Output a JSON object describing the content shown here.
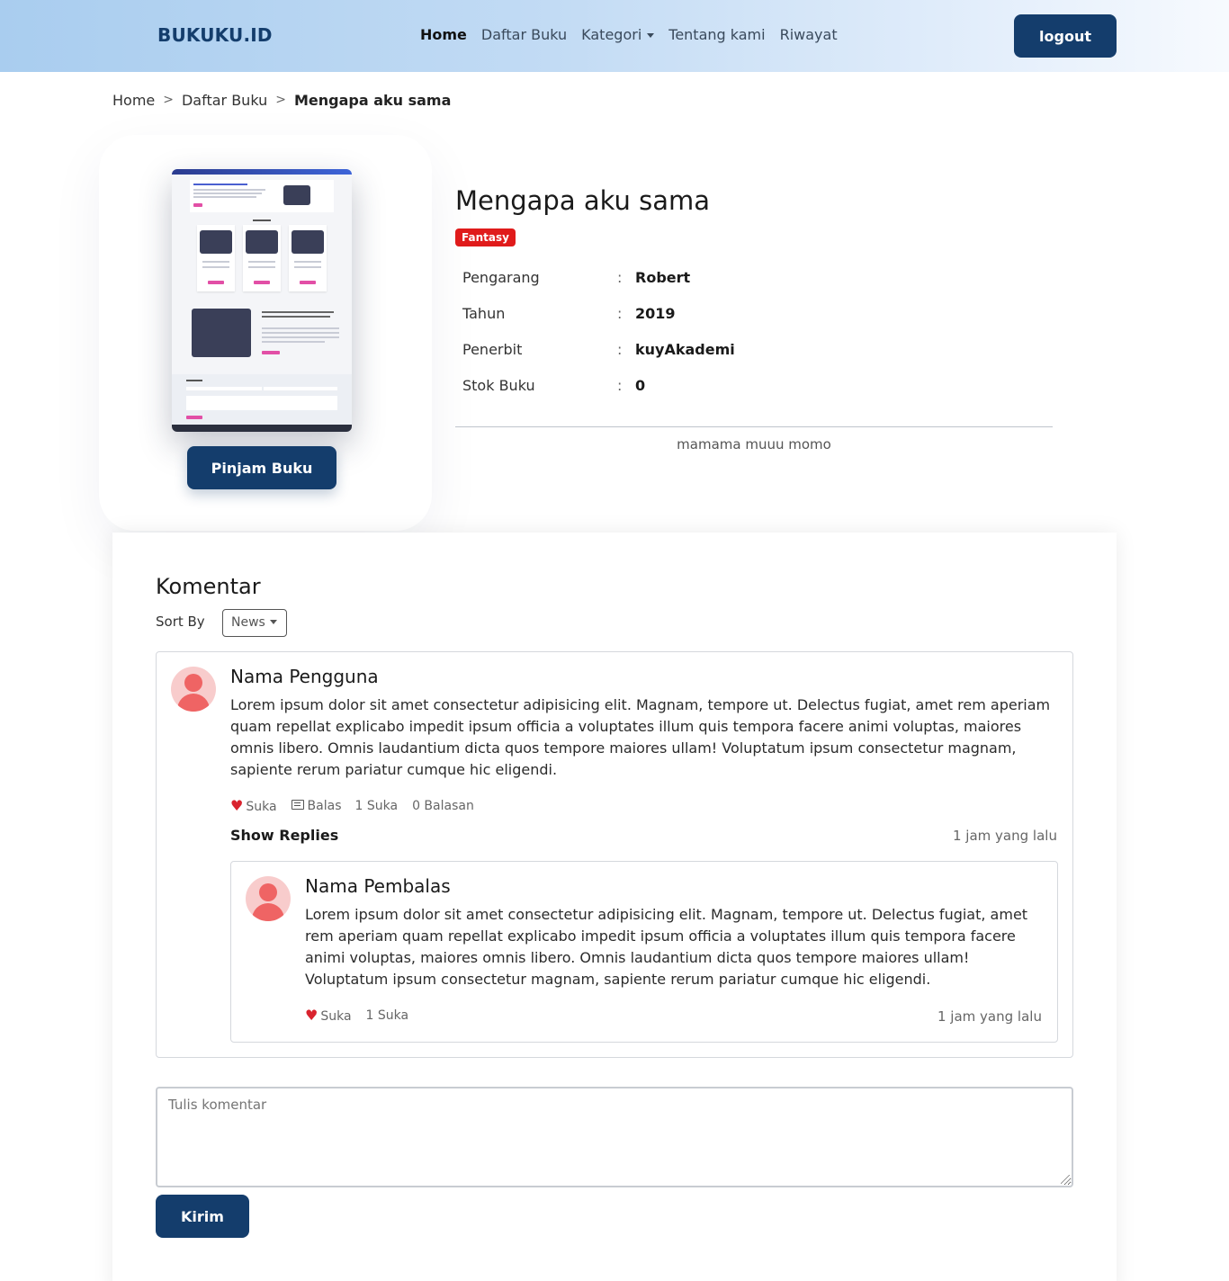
{
  "navbar": {
    "brand": "BUKUKU.ID",
    "links": [
      {
        "label": "Home",
        "active": true
      },
      {
        "label": "Daftar Buku"
      },
      {
        "label": "Kategori",
        "dropdown": true
      },
      {
        "label": "Tentang kami"
      },
      {
        "label": "Riwayat"
      }
    ],
    "logout_label": "logout",
    "colors": {
      "primary": "#143d6c"
    }
  },
  "breadcrumb": {
    "items": [
      "Home",
      "Daftar Buku"
    ],
    "separator": ">",
    "current": "Mengapa aku sama"
  },
  "book": {
    "cover_icon": "book-cover-image",
    "borrow_label": "Pinjam Buku",
    "title": "Mengapa aku sama",
    "category": "Fantasy",
    "category_color": "#e01b1b",
    "details": [
      {
        "label": "Pengarang",
        "value": "Robert"
      },
      {
        "label": "Tahun",
        "value": "2019"
      },
      {
        "label": "Penerbit",
        "value": "kuyAkademi"
      },
      {
        "label": "Stok Buku",
        "value": "0"
      }
    ],
    "colon": ":",
    "description": "mamama muuu momo"
  },
  "comments": {
    "title": "Komentar",
    "sort_label": "Sort By",
    "sort_value": "News",
    "items": [
      {
        "name": "Nama Pengguna",
        "text": "Lorem ipsum dolor sit amet consectetur adipisicing elit. Magnam, tempore ut. Delectus fugiat, amet rem aperiam quam repellat explicabo impedit ipsum officia a voluptates illum quis tempora facere animi voluptas, maiores omnis libero. Omnis laudantium dicta quos tempore maiores ullam! Voluptatum ipsum consectetur magnam, sapiente rerum pariatur cumque hic eligendi.",
        "like_label": "Suka",
        "reply_label": "Balas",
        "like_count": "1 Suka",
        "reply_count": "0 Balasan",
        "show_replies": "Show Replies",
        "time": "1 jam yang lalu",
        "replies": [
          {
            "name": "Nama Pembalas",
            "text": "Lorem ipsum dolor sit amet consectetur adipisicing elit. Magnam, tempore ut. Delectus fugiat, amet rem aperiam quam repellat explicabo impedit ipsum officia a voluptates illum quis tempora facere animi voluptas, maiores omnis libero. Omnis laudantium dicta quos tempore maiores ullam! Voluptatum ipsum consectetur magnam, sapiente rerum pariatur cumque hic eligendi.",
            "like_label": "Suka",
            "like_count": "1 Suka",
            "time": "1 jam yang lalu"
          }
        ]
      }
    ],
    "input_placeholder": "Tulis komentar",
    "submit_label": "Kirim"
  }
}
